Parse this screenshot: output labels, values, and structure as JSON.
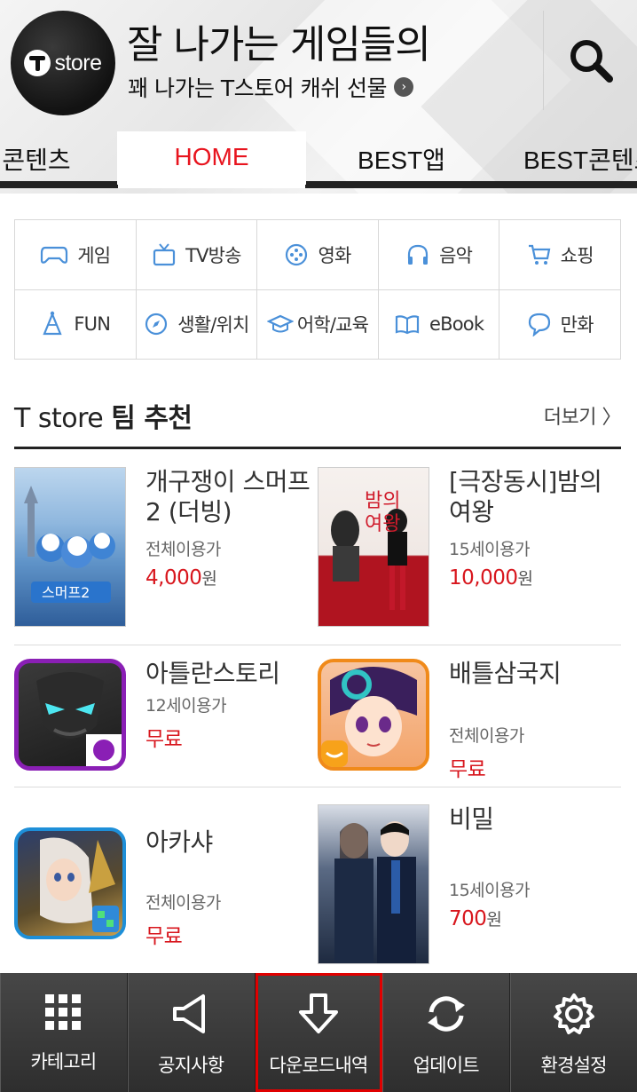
{
  "header": {
    "logo_text": "store",
    "banner_title": "잘 나가는 게임들의",
    "banner_subtitle": "꽤 나가는 T스토어 캐쉬 선물",
    "search_icon": "search-icon"
  },
  "tabs": [
    {
      "label": "콘텐츠",
      "active": false
    },
    {
      "label": "HOME",
      "active": true
    },
    {
      "label": "BEST앱",
      "active": false
    },
    {
      "label": "BEST콘텐츠",
      "active": false
    }
  ],
  "categories": [
    {
      "label": "게임",
      "icon": "gamepad-icon"
    },
    {
      "label": "TV방송",
      "icon": "tv-icon"
    },
    {
      "label": "영화",
      "icon": "film-reel-icon"
    },
    {
      "label": "음악",
      "icon": "headphones-icon"
    },
    {
      "label": "쇼핑",
      "icon": "cart-icon"
    },
    {
      "label": "FUN",
      "icon": "party-hat-icon"
    },
    {
      "label": "생활/위치",
      "icon": "compass-icon"
    },
    {
      "label": "어학/교육",
      "icon": "graduation-cap-icon"
    },
    {
      "label": "eBook",
      "icon": "book-icon"
    },
    {
      "label": "만화",
      "icon": "speech-bubble-icon"
    }
  ],
  "section": {
    "title_prefix": "T store ",
    "title_bold": "팀 추천",
    "more_label": "더보기 〉"
  },
  "products": [
    {
      "title": "개구쟁이 스머프 2 (더빙)",
      "age": "전체이용가",
      "price": "4,000",
      "unit": "원"
    },
    {
      "title": "[극장동시]밤의 여왕",
      "age": "15세이용가",
      "price": "10,000",
      "unit": "원"
    },
    {
      "title": "아틀란스토리",
      "age": "12세이용가",
      "price": "무료",
      "unit": ""
    },
    {
      "title": "배틀삼국지",
      "age": "전체이용가",
      "price": "무료",
      "unit": ""
    },
    {
      "title": "아카샤",
      "age": "전체이용가",
      "price": "무료",
      "unit": ""
    },
    {
      "title": "비밀",
      "age": "15세이용가",
      "price": "700",
      "unit": "원"
    }
  ],
  "bottom_nav": [
    {
      "label": "카테고리",
      "icon": "grid-icon"
    },
    {
      "label": "공지사항",
      "icon": "megaphone-icon"
    },
    {
      "label": "다운로드내역",
      "icon": "download-arrow-icon",
      "highlighted": true
    },
    {
      "label": "업데이트",
      "icon": "refresh-icon"
    },
    {
      "label": "환경설정",
      "icon": "gear-icon"
    }
  ],
  "colors": {
    "accent_red": "#e8141e",
    "price_red": "#d8161d",
    "icon_blue": "#4a90d9",
    "bottom_bar": "#3a3a3a"
  }
}
